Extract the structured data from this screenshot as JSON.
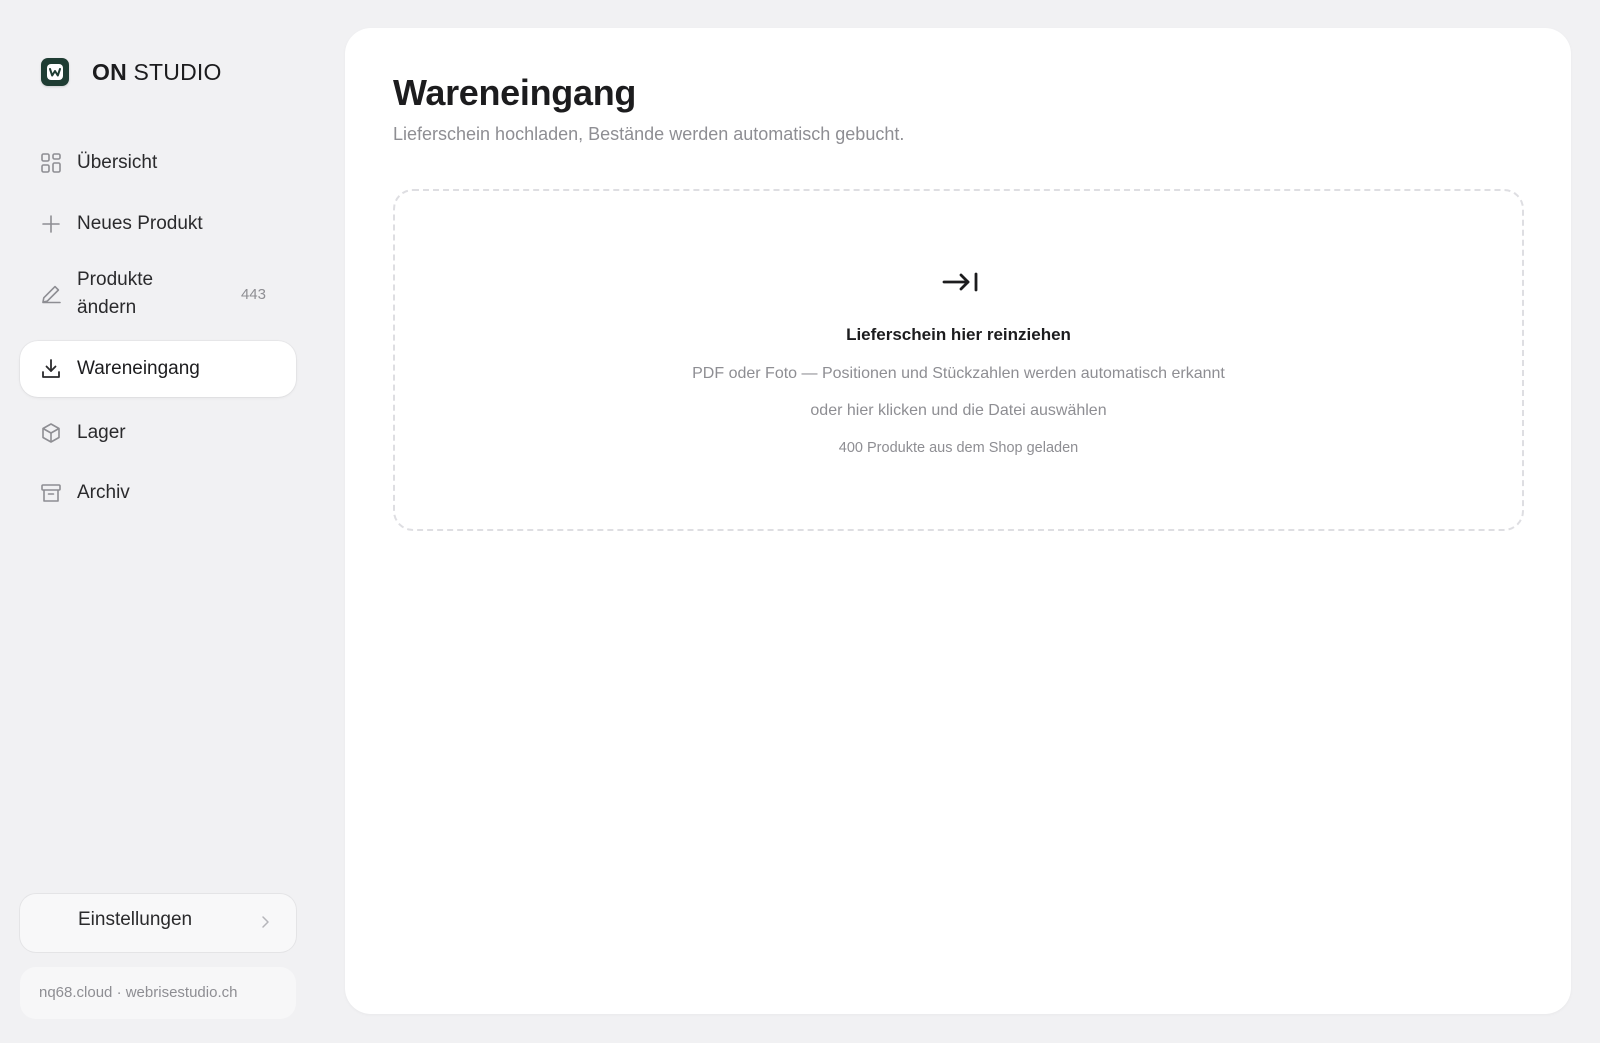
{
  "brand": {
    "name_bold": "ON",
    "name_light": "STUDIO",
    "logo_icon": "w-logo-icon",
    "accent": "#1f3d33"
  },
  "sidebar": {
    "items": [
      {
        "label": "Übersicht",
        "icon": "grid-icon",
        "active": false
      },
      {
        "label": "Neues Produkt",
        "icon": "plus-icon",
        "active": false
      },
      {
        "label": "Produkte ändern",
        "icon": "pencil-icon",
        "count": "443",
        "active": false
      },
      {
        "label": "Wareneingang",
        "icon": "download-icon",
        "active": true
      },
      {
        "label": "Lager",
        "icon": "box-icon",
        "active": false
      },
      {
        "label": "Archiv",
        "icon": "archive-icon",
        "active": false
      }
    ],
    "settings": {
      "label": "Einstellungen",
      "icon": "chevron-right-icon"
    },
    "footer": "nq68.cloud · webrisestudio.ch"
  },
  "main": {
    "title": "Wareneingang",
    "subtitle": "Lieferschein hochladen, Bestände werden automatisch gebucht.",
    "dropzone": {
      "icon": "arrow-to-line-icon",
      "title": "Lieferschein hier reinziehen",
      "line1": "PDF oder Foto — Positionen und Stückzahlen werden automatisch erkannt",
      "line2": "oder hier klicken und die Datei auswählen",
      "line3": "400 Produkte aus dem Shop geladen"
    }
  }
}
